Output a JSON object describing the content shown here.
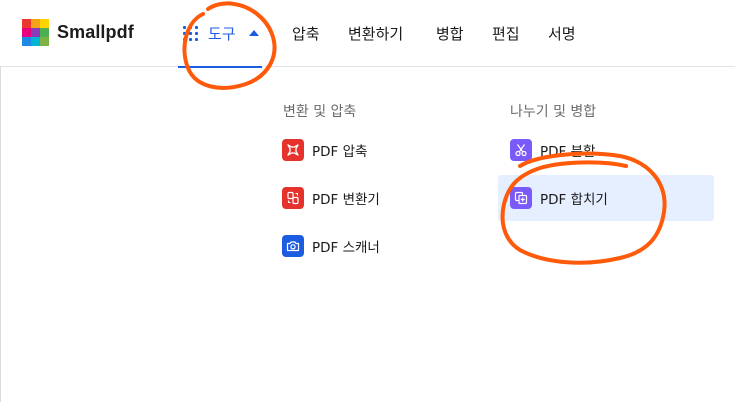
{
  "brand": {
    "name": "Smallpdf",
    "logo_colors": [
      "#e8392c",
      "#f7a21b",
      "#ffd200",
      "#e6007e",
      "#8a3ab9",
      "#4caf50",
      "#1e88e5",
      "#00b4d8",
      "#7cb342"
    ]
  },
  "nav": {
    "tools_label": "도구",
    "items": [
      "압축",
      "변환하기",
      "병합",
      "편집",
      "서명"
    ]
  },
  "menu": {
    "columns": [
      {
        "title": "변환 및 압축",
        "items": [
          {
            "label": "PDF 압축",
            "icon": "compress-icon",
            "color": "#e5322d"
          },
          {
            "label": "PDF 변환기",
            "icon": "convert-icon",
            "color": "#e5322d"
          },
          {
            "label": "PDF 스캐너",
            "icon": "camera-icon",
            "color": "#1c5ce0"
          }
        ]
      },
      {
        "title": "나누기 및 병합",
        "items": [
          {
            "label": "PDF 분할",
            "icon": "scissors-icon",
            "color": "#7a5af8"
          },
          {
            "label": "PDF 합치기",
            "icon": "merge-icon",
            "color": "#7a5af8",
            "active": true
          }
        ]
      }
    ]
  },
  "colors": {
    "accent": "#1c5ce0",
    "active_row_bg": "#e6efff",
    "annotation_stroke": "#ff5a0a"
  }
}
